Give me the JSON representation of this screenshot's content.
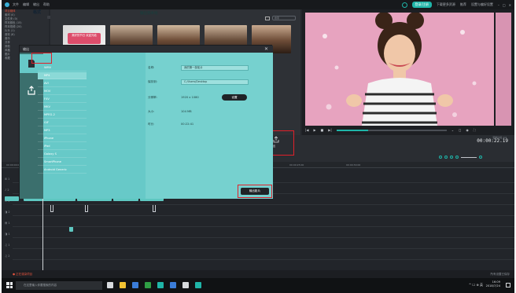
{
  "topbar": {
    "menu": [
      "文件",
      "编辑",
      "输出",
      "帮助"
    ],
    "sign_in": "登录/注册",
    "right_links": [
      "下载更多资源",
      "推荐",
      "设置与偏好设置"
    ]
  },
  "media_tree": [
    {
      "label": "项目媒体",
      "active": true
    },
    {
      "label": "素材 (0)",
      "active": false
    },
    {
      "label": "文件夹 (0)",
      "active": false
    },
    {
      "label": "样本颜色 (15)",
      "active": false
    },
    {
      "label": "样本视频 (20)",
      "active": false
    },
    {
      "label": "片头 (1)",
      "active": false
    },
    {
      "label": "音效 (8)",
      "active": false
    },
    {
      "label": "音乐",
      "active": false
    },
    {
      "label": "共享",
      "active": false
    },
    {
      "label": "其他",
      "active": false
    },
    {
      "label": "风格",
      "active": false
    },
    {
      "label": "图片",
      "active": false
    },
    {
      "label": "收藏",
      "active": false
    }
  ],
  "library": {
    "search_placeholder": "搜索",
    "badge_text": "美好的节日 欢迎光临"
  },
  "preview": {
    "controls": [
      "|◀",
      "▶",
      "■",
      "▶|"
    ],
    "right_controls": [
      "⌄",
      "◻",
      "◉",
      "⛶"
    ]
  },
  "timeline": {
    "timecode_label": "复制片段 1/4",
    "timecode": "00:00:22.19",
    "ruler": [
      "00:00:00:00",
      "00:00:05:00",
      "00:00:10:00",
      "00:00:15:00",
      "00:00:20:00",
      "00:00:25:00",
      "00:00:30:00"
    ],
    "tracks": [
      "⊞ 1",
      "♪ 2",
      "⊙ 1",
      "◨ 2",
      "▤ 1",
      "◨ 1",
      "♫ 1",
      "♫ 2"
    ]
  },
  "status": {
    "left": "● 正在渲染项目",
    "right": "所有设置已保存"
  },
  "taskbar": {
    "search": "在这里输入你要搜索的内容",
    "tray": "^ ☐ ⊕ 英",
    "time": "16:09",
    "date": "2018/7/24"
  },
  "export_dialog": {
    "title": "输出",
    "close": "✕",
    "format_heading": "格式",
    "formats": [
      "WMV",
      "MP4",
      "AVI",
      "MOV",
      "F4V",
      "MKV",
      "MPEG-2",
      "GIF",
      "MP3",
      "iPhone",
      "iPad",
      "Galaxy S",
      "SmartPhone",
      "Android Generic"
    ],
    "selected_format": "MP4",
    "output_heading": "输出到本地",
    "name_label": "名称:",
    "name_value": "我的第一部影片",
    "save_label": "保存到:",
    "save_value": "C:/Users/Desktop",
    "resolution_label": "分辨率:",
    "resolution_value": "1920 x 1080",
    "settings_button": "设置",
    "size_label": "大小:",
    "size_value": "104 MB",
    "duration_label": "时长:",
    "duration_value": "00:22:41",
    "export_button": "输出影片"
  },
  "export_side_button": "输出",
  "colors": {
    "accent": "#1fb5a8",
    "dialog_bg": "#67c9c8",
    "highlight": "#e0202a"
  }
}
